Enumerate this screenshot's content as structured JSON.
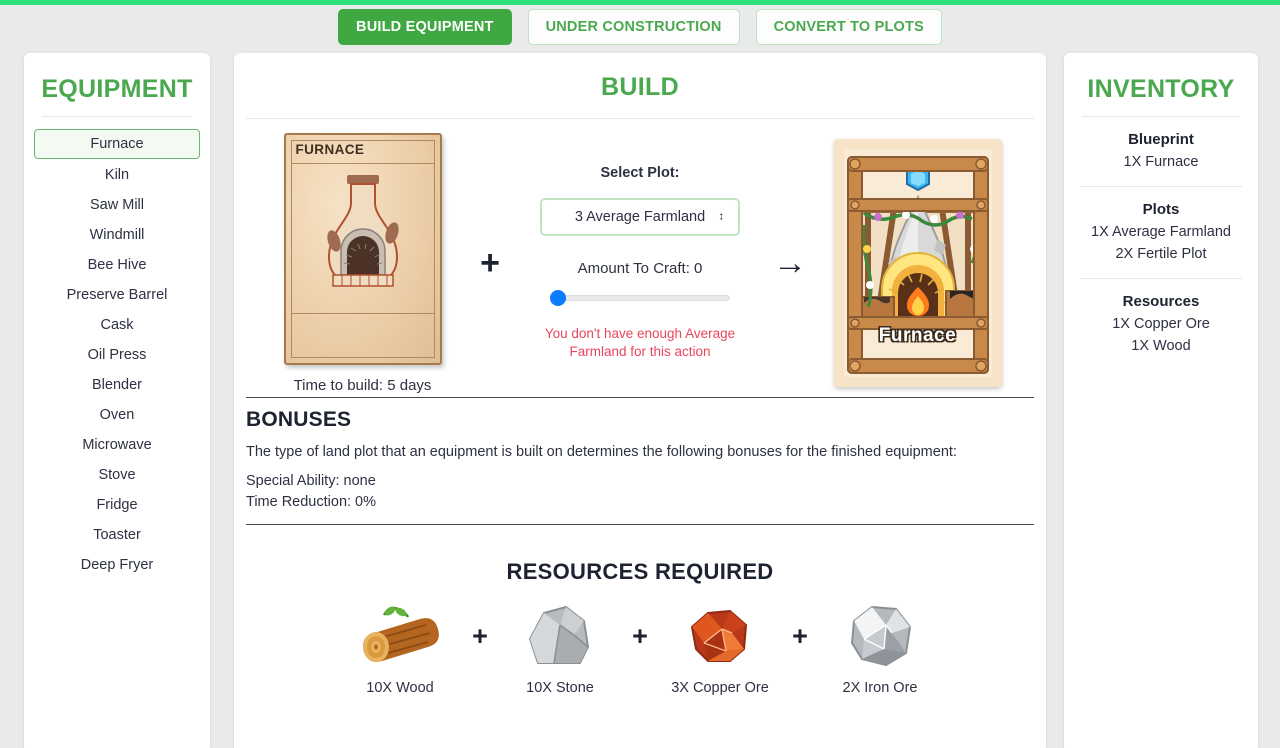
{
  "theme": {
    "accent_green": "#4aa84e",
    "tab_active_bg": "#3fa843",
    "top_strip": "#2fe07c",
    "warning_red": "#e8465c",
    "slider_blue": "#0a7cfc",
    "page_bg": "#e9eaea"
  },
  "tabs": [
    {
      "label": "BUILD EQUIPMENT",
      "state": "active"
    },
    {
      "label": "UNDER CONSTRUCTION",
      "state": "inactive"
    },
    {
      "label": "CONVERT TO PLOTS",
      "state": "inactive"
    }
  ],
  "equipment": {
    "title": "EQUIPMENT",
    "selected": "Furnace",
    "items": [
      {
        "label": "Furnace"
      },
      {
        "label": "Kiln"
      },
      {
        "label": "Saw Mill"
      },
      {
        "label": "Windmill"
      },
      {
        "label": "Bee Hive"
      },
      {
        "label": "Preserve Barrel"
      },
      {
        "label": "Cask"
      },
      {
        "label": "Oil Press"
      },
      {
        "label": "Blender"
      },
      {
        "label": "Oven"
      },
      {
        "label": "Microwave"
      },
      {
        "label": "Stove"
      },
      {
        "label": "Fridge"
      },
      {
        "label": "Toaster"
      },
      {
        "label": "Deep Fryer"
      }
    ]
  },
  "build": {
    "title": "BUILD",
    "blueprint": {
      "name": "FURNACE",
      "time_to_build": "Time to build: 5 days"
    },
    "operator_plus": "+",
    "operator_arrow": "→",
    "select_plot_label": "Select Plot:",
    "plot_select": {
      "value": "3 Average Farmland",
      "caret": "↕",
      "options": [
        "3 Average Farmland"
      ]
    },
    "amount_label": "Amount To Craft: 0",
    "amount_value": 0,
    "slider": {
      "value": 0,
      "min": 0,
      "max": 0,
      "fill_percent": 0
    },
    "warning": "You don't have enough Average Farmland for this action",
    "result": {
      "name": "Furnace"
    },
    "bonuses": {
      "title": "BONUSES",
      "description": "The type of land plot that an equipment is built on determines the following bonuses for the finished equipment:",
      "special_ability": "Special Ability: none",
      "time_reduction": "Time Reduction: 0%"
    },
    "resources": {
      "title": "RESOURCES REQUIRED",
      "separator": "+",
      "items": [
        {
          "label": "10X Wood",
          "icon": "wood-log-icon"
        },
        {
          "label": "10X Stone",
          "icon": "stone-rock-icon"
        },
        {
          "label": "3X Copper Ore",
          "icon": "copper-ore-icon"
        },
        {
          "label": "2X Iron Ore",
          "icon": "iron-ore-icon"
        }
      ]
    }
  },
  "inventory": {
    "title": "INVENTORY",
    "groups": [
      {
        "title": "Blueprint",
        "entries": [
          "1X Furnace"
        ]
      },
      {
        "title": "Plots",
        "entries": [
          "1X Average Farmland",
          "2X Fertile Plot"
        ]
      },
      {
        "title": "Resources",
        "entries": [
          "1X Copper Ore",
          "1X Wood"
        ]
      }
    ]
  }
}
